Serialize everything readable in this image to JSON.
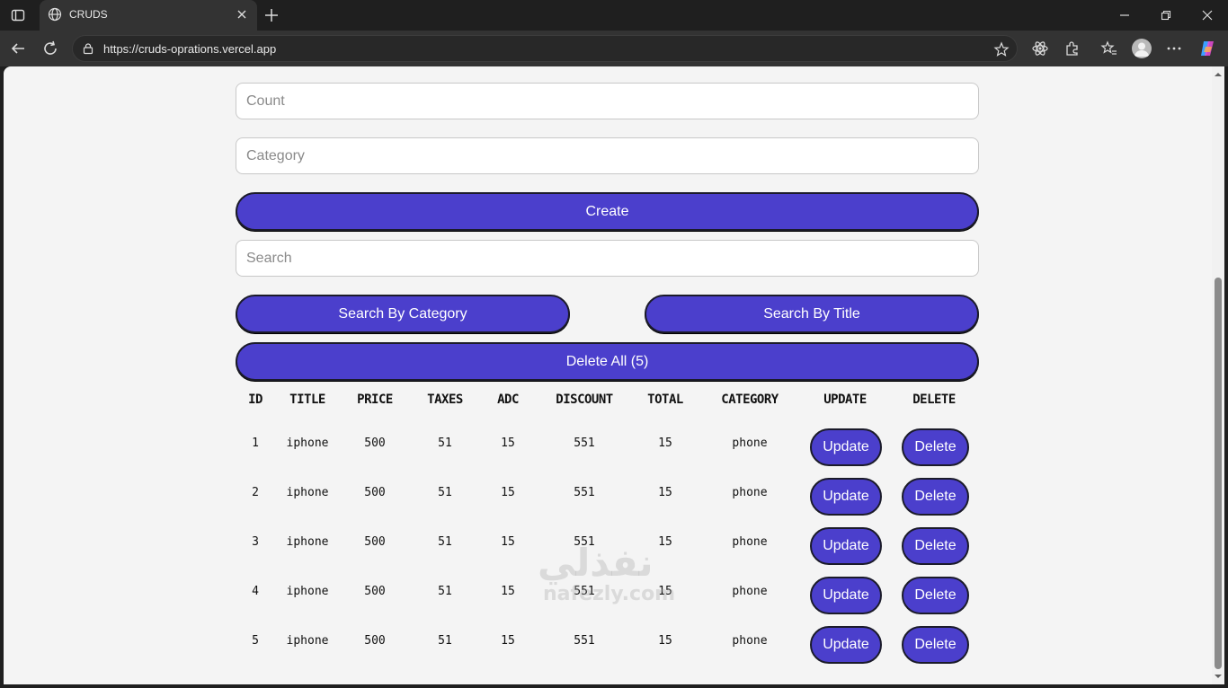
{
  "browser": {
    "tab_title": "CRUDS",
    "url": "https://cruds-oprations.vercel.app"
  },
  "form": {
    "count_placeholder": "Count",
    "category_placeholder": "Category",
    "create_label": "Create",
    "search_placeholder": "Search",
    "search_by_category_label": "Search By Category",
    "search_by_title_label": "Search By Title",
    "delete_all_label": "Delete All (5)"
  },
  "table": {
    "headers": [
      "ID",
      "TITLE",
      "PRICE",
      "TAXES",
      "ADC",
      "DISCOUNT",
      "TOTAL",
      "CATEGORY",
      "UPDATE",
      "DELETE"
    ],
    "rows": [
      {
        "id": "1",
        "title": "iphone",
        "price": "500",
        "taxes": "51",
        "ads": "15",
        "discount": "551",
        "total": "15",
        "category": "phone"
      },
      {
        "id": "2",
        "title": "iphone",
        "price": "500",
        "taxes": "51",
        "ads": "15",
        "discount": "551",
        "total": "15",
        "category": "phone"
      },
      {
        "id": "3",
        "title": "iphone",
        "price": "500",
        "taxes": "51",
        "ads": "15",
        "discount": "551",
        "total": "15",
        "category": "phone"
      },
      {
        "id": "4",
        "title": "iphone",
        "price": "500",
        "taxes": "51",
        "ads": "15",
        "discount": "551",
        "total": "15",
        "category": "phone"
      },
      {
        "id": "5",
        "title": "iphone",
        "price": "500",
        "taxes": "51",
        "ads": "15",
        "discount": "551",
        "total": "15",
        "category": "phone"
      }
    ],
    "update_label": "Update",
    "delete_label": "Delete"
  },
  "watermark": {
    "arabic": "نفذلي",
    "latin": "nafezly.com"
  },
  "colors": {
    "accent": "#4b3fcc",
    "page_bg": "#f4f4f4",
    "chrome_bg": "#1f1f1f"
  }
}
